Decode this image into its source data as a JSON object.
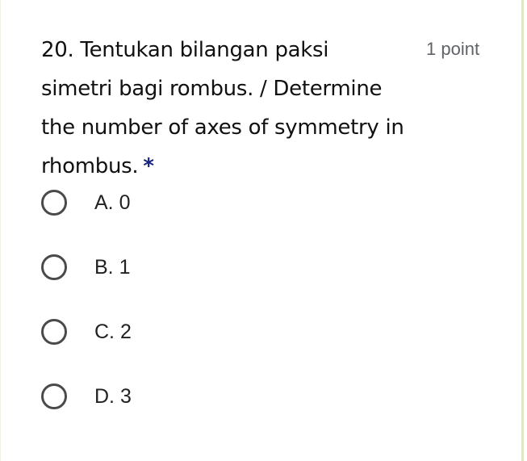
{
  "question": {
    "title": "20. Tentukan bilangan paksi simetri bagi rombus. / Determine the number of axes of symmetry in rhombus.",
    "required_marker": "*",
    "points_label": "1 point"
  },
  "options": [
    {
      "label": "A. 0",
      "selected": false
    },
    {
      "label": "B. 1",
      "selected": false
    },
    {
      "label": "C. 2",
      "selected": false
    },
    {
      "label": "D. 3",
      "selected": false
    }
  ],
  "colors": {
    "required_star": "#1a237e",
    "radio_border": "#4a4a4a",
    "points_text": "#5f6368",
    "card_border": "#dfe8c8"
  }
}
